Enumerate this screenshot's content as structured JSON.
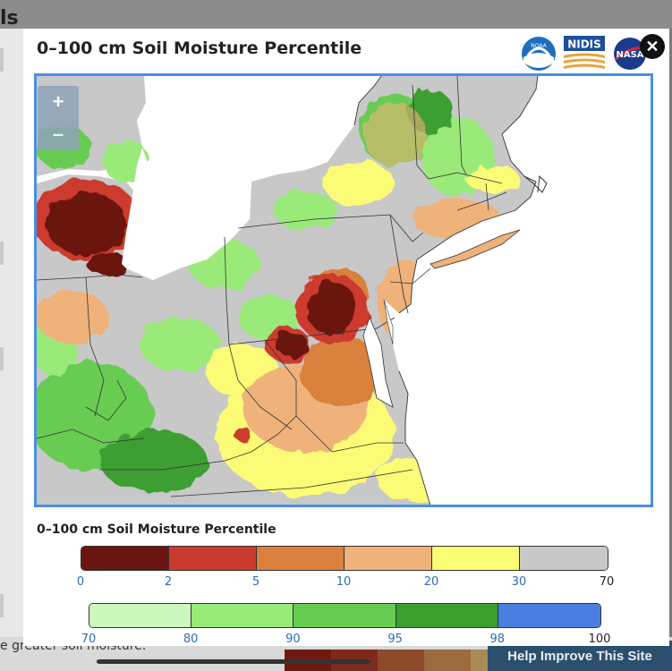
{
  "background": {
    "heading_fragment": "ls",
    "caption_fragment": "e greater soil moisture.",
    "help_label": "Help Improve This Site",
    "bar_colors": [
      "#6e1a12",
      "#7e2a1e",
      "#8c4a2a",
      "#9b6a3e",
      "#a88a55"
    ]
  },
  "modal": {
    "title": "0–100 cm Soil Moisture Percentile",
    "logos": [
      {
        "name": "noara-logo",
        "text": "NOAA"
      },
      {
        "name": "nidis-logo",
        "text": "NIDIS"
      },
      {
        "name": "nasa-logo",
        "text": "NASA"
      }
    ],
    "close_glyph": "✕",
    "zoom_in": "+",
    "zoom_out": "–"
  },
  "legend": {
    "title": "0–100 cm Soil Moisture Percentile",
    "dry": {
      "colors": [
        "#6b1510",
        "#cc3a2e",
        "#d9813d",
        "#efb27a",
        "#fbfb74",
        "#c8c8c8"
      ],
      "ticks": [
        "0",
        "2",
        "5",
        "10",
        "20",
        "30",
        "70"
      ],
      "tick_colors": [
        "#2a6db8",
        "#2a6db8",
        "#2a6db8",
        "#2a6db8",
        "#2a6db8",
        "#2a6db8",
        "#222222"
      ]
    },
    "wet": {
      "colors": [
        "#ccf7bd",
        "#9aea7a",
        "#68cc52",
        "#3d9e30",
        "#4a7fe0"
      ],
      "ticks": [
        "70",
        "80",
        "90",
        "95",
        "98",
        "100"
      ],
      "tick_colors": [
        "#2a6db8",
        "#2a6db8",
        "#2a6db8",
        "#2a6db8",
        "#2a6db8",
        "#222222"
      ]
    }
  }
}
